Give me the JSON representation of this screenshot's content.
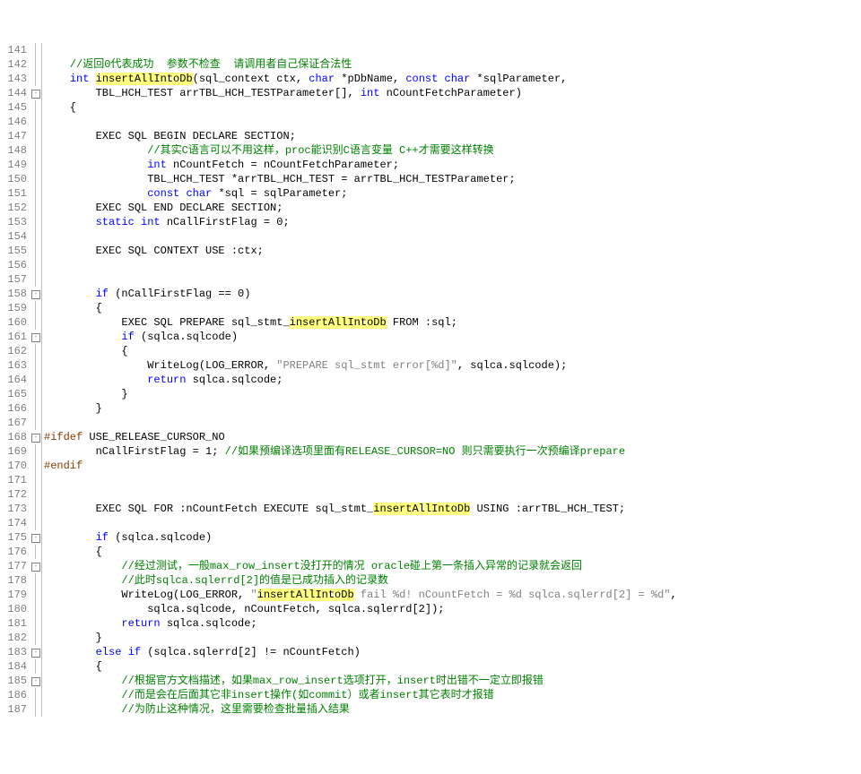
{
  "lines": [
    {
      "n": 141,
      "f": "l",
      "h": ""
    },
    {
      "n": 142,
      "f": "l",
      "h": "    //返回0代表成功  参数不检查  请调用者自己保证合法性",
      "cls": "cm"
    },
    {
      "n": 143,
      "f": "l",
      "seg": [
        [
          "    ",
          "n"
        ],
        [
          "int",
          "kw"
        ],
        [
          " ",
          "n"
        ],
        [
          "insertAllIntoDb",
          "hl"
        ],
        [
          "(sql_context ctx, ",
          "n"
        ],
        [
          "char",
          "kw"
        ],
        [
          " *pDbName, ",
          "n"
        ],
        [
          "const",
          "kw"
        ],
        [
          " ",
          "n"
        ],
        [
          "char",
          "kw"
        ],
        [
          " *sqlParameter,",
          "n"
        ]
      ]
    },
    {
      "n": 144,
      "f": "b",
      "seg": [
        [
          "        TBL_HCH_TEST arrTBL_HCH_TESTParameter[], ",
          "n"
        ],
        [
          "int",
          "kw"
        ],
        [
          " nCountFetchParameter)",
          "n"
        ]
      ]
    },
    {
      "n": 145,
      "f": "l",
      "h": "    {",
      "cls": "n"
    },
    {
      "n": 146,
      "f": "l",
      "h": ""
    },
    {
      "n": 147,
      "f": "l",
      "seg": [
        [
          "        EXEC SQL BEGIN DECLARE SECTION;",
          "n"
        ]
      ]
    },
    {
      "n": 148,
      "f": "l",
      "seg": [
        [
          "                ",
          "n"
        ],
        [
          "//其实C语言可以不用这样，proc能识别C语言变量 C++才需要这样转换",
          "cm"
        ]
      ]
    },
    {
      "n": 149,
      "f": "l",
      "seg": [
        [
          "                ",
          "n"
        ],
        [
          "int",
          "kw"
        ],
        [
          " nCountFetch = nCountFetchParameter;",
          "n"
        ]
      ]
    },
    {
      "n": 150,
      "f": "l",
      "seg": [
        [
          "                TBL_HCH_TEST *arrTBL_HCH_TEST = arrTBL_HCH_TESTParameter;",
          "n"
        ]
      ]
    },
    {
      "n": 151,
      "f": "l",
      "seg": [
        [
          "                ",
          "n"
        ],
        [
          "const",
          "kw"
        ],
        [
          " ",
          "n"
        ],
        [
          "char",
          "kw"
        ],
        [
          " *sql = sqlParameter;",
          "n"
        ]
      ]
    },
    {
      "n": 152,
      "f": "l",
      "seg": [
        [
          "        EXEC SQL END DECLARE SECTION;",
          "n"
        ]
      ]
    },
    {
      "n": 153,
      "f": "l",
      "seg": [
        [
          "        ",
          "n"
        ],
        [
          "static",
          "kw"
        ],
        [
          " ",
          "n"
        ],
        [
          "int",
          "kw"
        ],
        [
          " nCallFirstFlag = 0;",
          "n"
        ]
      ]
    },
    {
      "n": 154,
      "f": "l",
      "h": ""
    },
    {
      "n": 155,
      "f": "l",
      "seg": [
        [
          "        EXEC SQL CONTEXT USE :ctx;",
          "n"
        ]
      ]
    },
    {
      "n": 156,
      "f": "l",
      "h": ""
    },
    {
      "n": 157,
      "f": "l",
      "h": ""
    },
    {
      "n": 158,
      "f": "b",
      "seg": [
        [
          "        ",
          "n"
        ],
        [
          "if",
          "kw"
        ],
        [
          " (nCallFirstFlag == 0)",
          "n"
        ]
      ]
    },
    {
      "n": 159,
      "f": "l",
      "h": "        {",
      "cls": "n"
    },
    {
      "n": 160,
      "f": "l",
      "seg": [
        [
          "            EXEC SQL PREPARE sql_stmt_",
          "n"
        ],
        [
          "insertAllIntoDb",
          "hl"
        ],
        [
          " FROM :sql;",
          "n"
        ]
      ]
    },
    {
      "n": 161,
      "f": "b",
      "seg": [
        [
          "            ",
          "n"
        ],
        [
          "if",
          "kw"
        ],
        [
          " (sqlca.sqlcode)",
          "n"
        ]
      ]
    },
    {
      "n": 162,
      "f": "l",
      "h": "            {",
      "cls": "n"
    },
    {
      "n": 163,
      "f": "l",
      "seg": [
        [
          "                WriteLog(LOG_ERROR, ",
          "n"
        ],
        [
          "\"PREPARE sql_stmt error[%d]\"",
          "str"
        ],
        [
          ", sqlca.sqlcode);",
          "n"
        ]
      ]
    },
    {
      "n": 164,
      "f": "l",
      "seg": [
        [
          "                ",
          "n"
        ],
        [
          "return",
          "kw"
        ],
        [
          " sqlca.sqlcode;",
          "n"
        ]
      ]
    },
    {
      "n": 165,
      "f": "l",
      "h": "            }",
      "cls": "n"
    },
    {
      "n": 166,
      "f": "l",
      "h": "        }",
      "cls": "n"
    },
    {
      "n": 167,
      "f": "l",
      "h": ""
    },
    {
      "n": 168,
      "f": "b",
      "seg": [
        [
          "#ifdef",
          "pp"
        ],
        [
          " USE_RELEASE_CURSOR_NO",
          "n"
        ]
      ]
    },
    {
      "n": 169,
      "f": "l",
      "seg": [
        [
          "        nCallFirstFlag = 1; ",
          "n"
        ],
        [
          "//如果预编译选项里面有RELEASE_CURSOR=NO 则只需要执行一次预编译prepare",
          "cm"
        ]
      ]
    },
    {
      "n": 170,
      "f": "l",
      "seg": [
        [
          "#endif",
          "pp"
        ]
      ]
    },
    {
      "n": 171,
      "f": "l",
      "h": ""
    },
    {
      "n": 172,
      "f": "l",
      "h": ""
    },
    {
      "n": 173,
      "f": "l",
      "seg": [
        [
          "        EXEC SQL FOR :nCountFetch EXECUTE sql_stmt_",
          "n"
        ],
        [
          "insertAllIntoDb",
          "hl"
        ],
        [
          " USING :arrTBL_HCH_TEST;",
          "n"
        ]
      ]
    },
    {
      "n": 174,
      "f": "l",
      "h": ""
    },
    {
      "n": 175,
      "f": "b",
      "seg": [
        [
          "        ",
          "n"
        ],
        [
          "if",
          "kw"
        ],
        [
          " (sqlca.sqlcode)",
          "n"
        ]
      ]
    },
    {
      "n": 176,
      "f": "l",
      "h": "        {",
      "cls": "n"
    },
    {
      "n": 177,
      "f": "b",
      "seg": [
        [
          "            ",
          "n"
        ],
        [
          "//经过测试，一般max_row_insert没打开的情况 oracle碰上第一条插入异常的记录就会返回",
          "cm"
        ]
      ]
    },
    {
      "n": 178,
      "f": "l",
      "seg": [
        [
          "            ",
          "n"
        ],
        [
          "//此时sqlca.sqlerrd[2]的值是已成功插入的记录数",
          "cm"
        ]
      ]
    },
    {
      "n": 179,
      "f": "l",
      "seg": [
        [
          "            WriteLog(LOG_ERROR, ",
          "n"
        ],
        [
          "\"",
          "str"
        ],
        [
          "insertAllIntoDb",
          "hl"
        ],
        [
          " fail %d! nCountFetch = %d sqlca.sqlerrd[2] = %d\"",
          "str"
        ],
        [
          ",",
          "n"
        ]
      ]
    },
    {
      "n": 180,
      "f": "l",
      "seg": [
        [
          "                sqlca.sqlcode, nCountFetch, sqlca.sqlerrd[2]);",
          "n"
        ]
      ]
    },
    {
      "n": 181,
      "f": "l",
      "seg": [
        [
          "            ",
          "n"
        ],
        [
          "return",
          "kw"
        ],
        [
          " sqlca.sqlcode;",
          "n"
        ]
      ]
    },
    {
      "n": 182,
      "f": "l",
      "h": "        }",
      "cls": "n"
    },
    {
      "n": 183,
      "f": "b",
      "seg": [
        [
          "        ",
          "n"
        ],
        [
          "else",
          "kw"
        ],
        [
          " ",
          "n"
        ],
        [
          "if",
          "kw"
        ],
        [
          " (sqlca.sqlerrd[2] != nCountFetch)",
          "n"
        ]
      ]
    },
    {
      "n": 184,
      "f": "l",
      "h": "        {",
      "cls": "n"
    },
    {
      "n": 185,
      "f": "b",
      "seg": [
        [
          "            ",
          "n"
        ],
        [
          "//根据官方文档描述，如果max_row_insert选项打开，insert时出错不一定立即报错",
          "cm"
        ]
      ]
    },
    {
      "n": 186,
      "f": "l",
      "seg": [
        [
          "            ",
          "n"
        ],
        [
          "//而是会在后面其它非insert操作(如commit）或者insert其它表时才报错",
          "cm"
        ]
      ]
    },
    {
      "n": 187,
      "f": "l",
      "seg": [
        [
          "            ",
          "n"
        ],
        [
          "//为防止这种情况，这里需要检查批量插入结果",
          "cm"
        ]
      ]
    }
  ]
}
